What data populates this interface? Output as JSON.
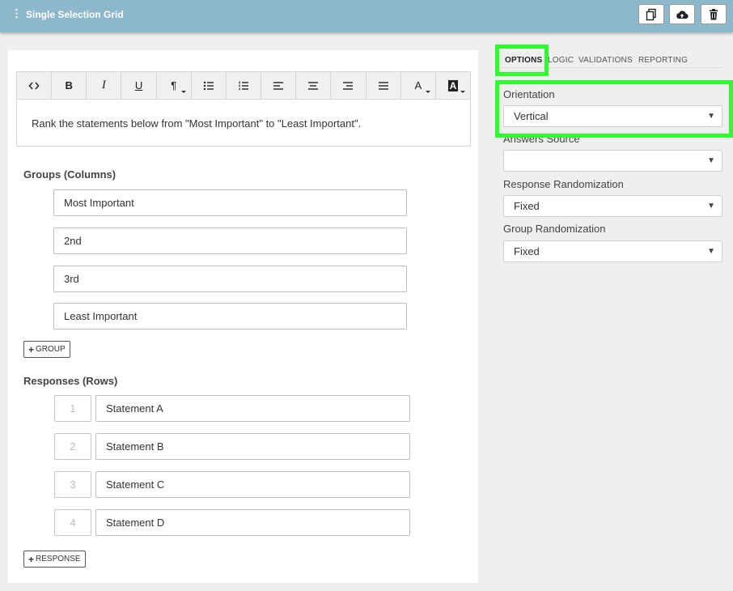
{
  "header": {
    "title": "Single Selection Grid",
    "info_icon": "info-icon",
    "buttons": [
      "copy-icon",
      "cloud-upload-icon",
      "trash-icon"
    ]
  },
  "editor": {
    "toolbar": {
      "bold": "B",
      "italic": "I",
      "underline": "U",
      "paragraph": "¶",
      "font_color": "A",
      "bg_color": "A"
    },
    "question_text": "Rank the statements below from \"Most Important\" to \"Least Important\"."
  },
  "groups": {
    "title": "Groups (Columns)",
    "items": [
      "Most Important",
      "2nd",
      "3rd",
      "Least Important"
    ],
    "add_label": "GROUP"
  },
  "responses": {
    "title": "Responses (Rows)",
    "items": [
      {
        "num": "1",
        "text": "Statement A"
      },
      {
        "num": "2",
        "text": "Statement B"
      },
      {
        "num": "3",
        "text": "Statement C"
      },
      {
        "num": "4",
        "text": "Statement D"
      }
    ],
    "add_label": "RESPONSE"
  },
  "panel": {
    "tabs": [
      "OPTIONS",
      "LOGIC",
      "VALIDATIONS",
      "REPORTING"
    ],
    "active_tab": "OPTIONS",
    "orientation": {
      "label": "Orientation",
      "value": "Vertical"
    },
    "answers_source": {
      "label": "Answers Source",
      "value": ""
    },
    "response_randomization": {
      "label": "Response Randomization",
      "value": "Fixed"
    },
    "group_randomization": {
      "label": "Group Randomization",
      "value": "Fixed"
    }
  },
  "colors": {
    "header_bg": "#8db8cb",
    "highlight": "#2dff2d"
  }
}
